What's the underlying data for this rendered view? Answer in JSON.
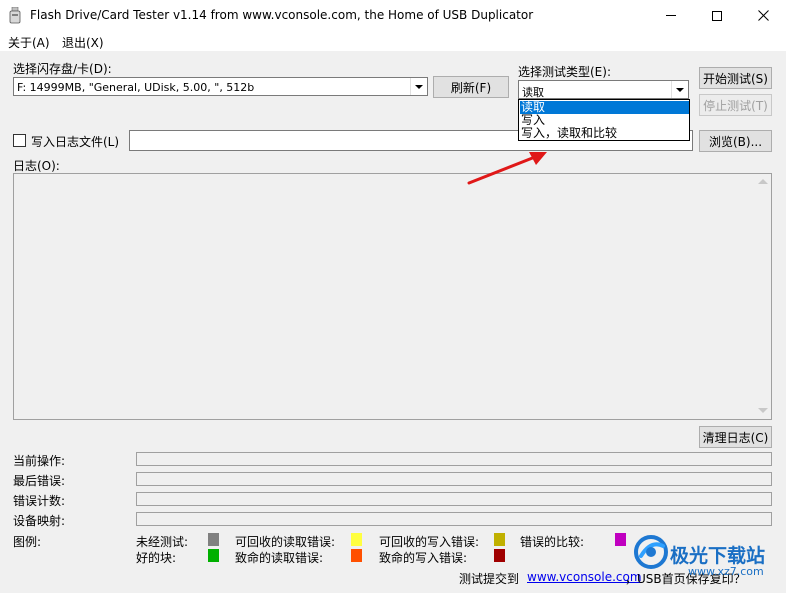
{
  "window": {
    "title": "Flash Drive/Card Tester v1.14 from www.vconsole.com, the Home of USB Duplicator"
  },
  "menu": {
    "about": "关于(A)",
    "exit": "退出(X)"
  },
  "drive": {
    "label": "选择闪存盘/卡(D):",
    "value": "F: 14999MB, \"General, UDisk, 5.00, \", 512b",
    "refresh_label": "刷新(F)"
  },
  "test_type": {
    "label": "选择测试类型(E):",
    "value": "读取",
    "options": [
      "读取",
      "写入",
      "写入，读取和比较"
    ],
    "selected_index": 0
  },
  "buttons": {
    "start": "开始测试(S)",
    "stop": "停止测试(T)",
    "browse": "浏览(B)...",
    "clear_log": "清理日志(C)"
  },
  "logfile": {
    "label": "写入日志文件(L)",
    "checked": false,
    "value": ""
  },
  "log": {
    "label": "日志(O):"
  },
  "status": {
    "current_op": "当前操作:",
    "last_error": "最后错误:",
    "error_count": "错误计数:",
    "device_map": "设备映射:"
  },
  "legend": {
    "title": "图例:",
    "items": [
      {
        "label": "未经测试:",
        "color": "#808080"
      },
      {
        "label": "可回收的读取错误:",
        "color": "#ffff40"
      },
      {
        "label": "可回收的写入错误:",
        "color": "#c0b000"
      },
      {
        "label": "错误的比较:",
        "color": "#c000c0"
      },
      {
        "label": "好的块:",
        "color": "#00b000"
      },
      {
        "label": "致命的读取错误:",
        "color": "#ff5000"
      },
      {
        "label": "致命的写入错误:",
        "color": "#a00000"
      }
    ]
  },
  "footer": {
    "submit_prefix": "测试提交到",
    "link_text": "www.vconsole.com",
    "suffix": "，USB首页保存复印？"
  },
  "watermark": {
    "text": "极光下载站",
    "url": "www.xz7.com"
  },
  "colors": {
    "selection": "#0078d7",
    "arrow": "#e01818"
  }
}
